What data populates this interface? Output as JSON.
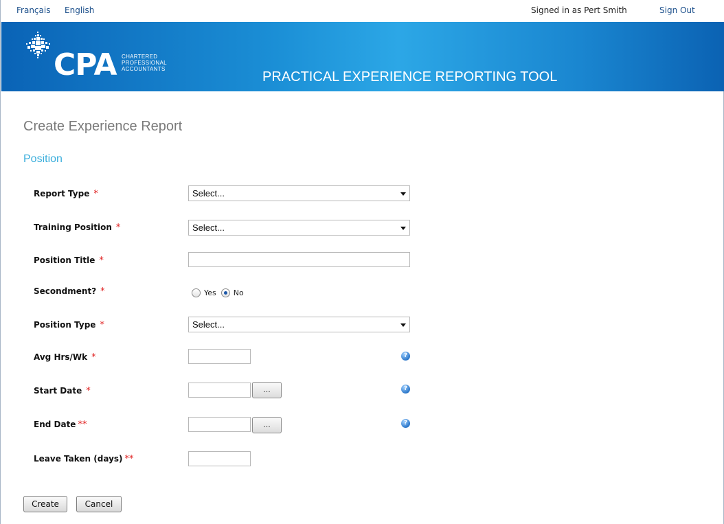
{
  "topbar": {
    "lang_fr": "Français",
    "lang_en": "English",
    "signed_in": "Signed in as Pert Smith",
    "sign_out": "Sign Out"
  },
  "banner": {
    "logo_text": "CPA",
    "logo_sub": [
      "CHARTERED",
      "PROFESSIONAL",
      "ACCOUNTANTS"
    ],
    "title": "PRACTICAL EXPERIENCE REPORTING TOOL",
    "colors": {
      "start": "#0a63b6",
      "mid": "#2ca7e6",
      "end": "#0b62b3"
    }
  },
  "page_title": "Create Experience Report",
  "section_title": "Position",
  "form": {
    "report_type": {
      "label": "Report Type",
      "required": "*",
      "value": "Select..."
    },
    "training_position": {
      "label": "Training Position",
      "required": "*",
      "value": "Select..."
    },
    "position_title": {
      "label": "Position Title",
      "required": "*",
      "value": ""
    },
    "secondment": {
      "label": "Secondment?",
      "required": "*",
      "options": [
        "Yes",
        "No"
      ],
      "selected": "No"
    },
    "position_type": {
      "label": "Position Type",
      "required": "*",
      "value": "Select..."
    },
    "avg_hrs": {
      "label": "Avg Hrs/Wk",
      "required": "*",
      "value": ""
    },
    "start_date": {
      "label": "Start Date",
      "required": "*",
      "value": "",
      "picker": "..."
    },
    "end_date": {
      "label": "End Date",
      "required": "**",
      "value": "",
      "picker": "..."
    },
    "leave_taken": {
      "label": "Leave Taken (days)",
      "required": "**",
      "value": ""
    }
  },
  "buttons": {
    "create": "Create",
    "cancel": "Cancel"
  },
  "icons": {
    "help": "help-icon",
    "dropdown": "chevron-down-icon",
    "logo": "maple-leaf-icon"
  },
  "colors": {
    "accent": "#3aaedc",
    "required": "#e02020",
    "link": "#1a4e8a"
  }
}
